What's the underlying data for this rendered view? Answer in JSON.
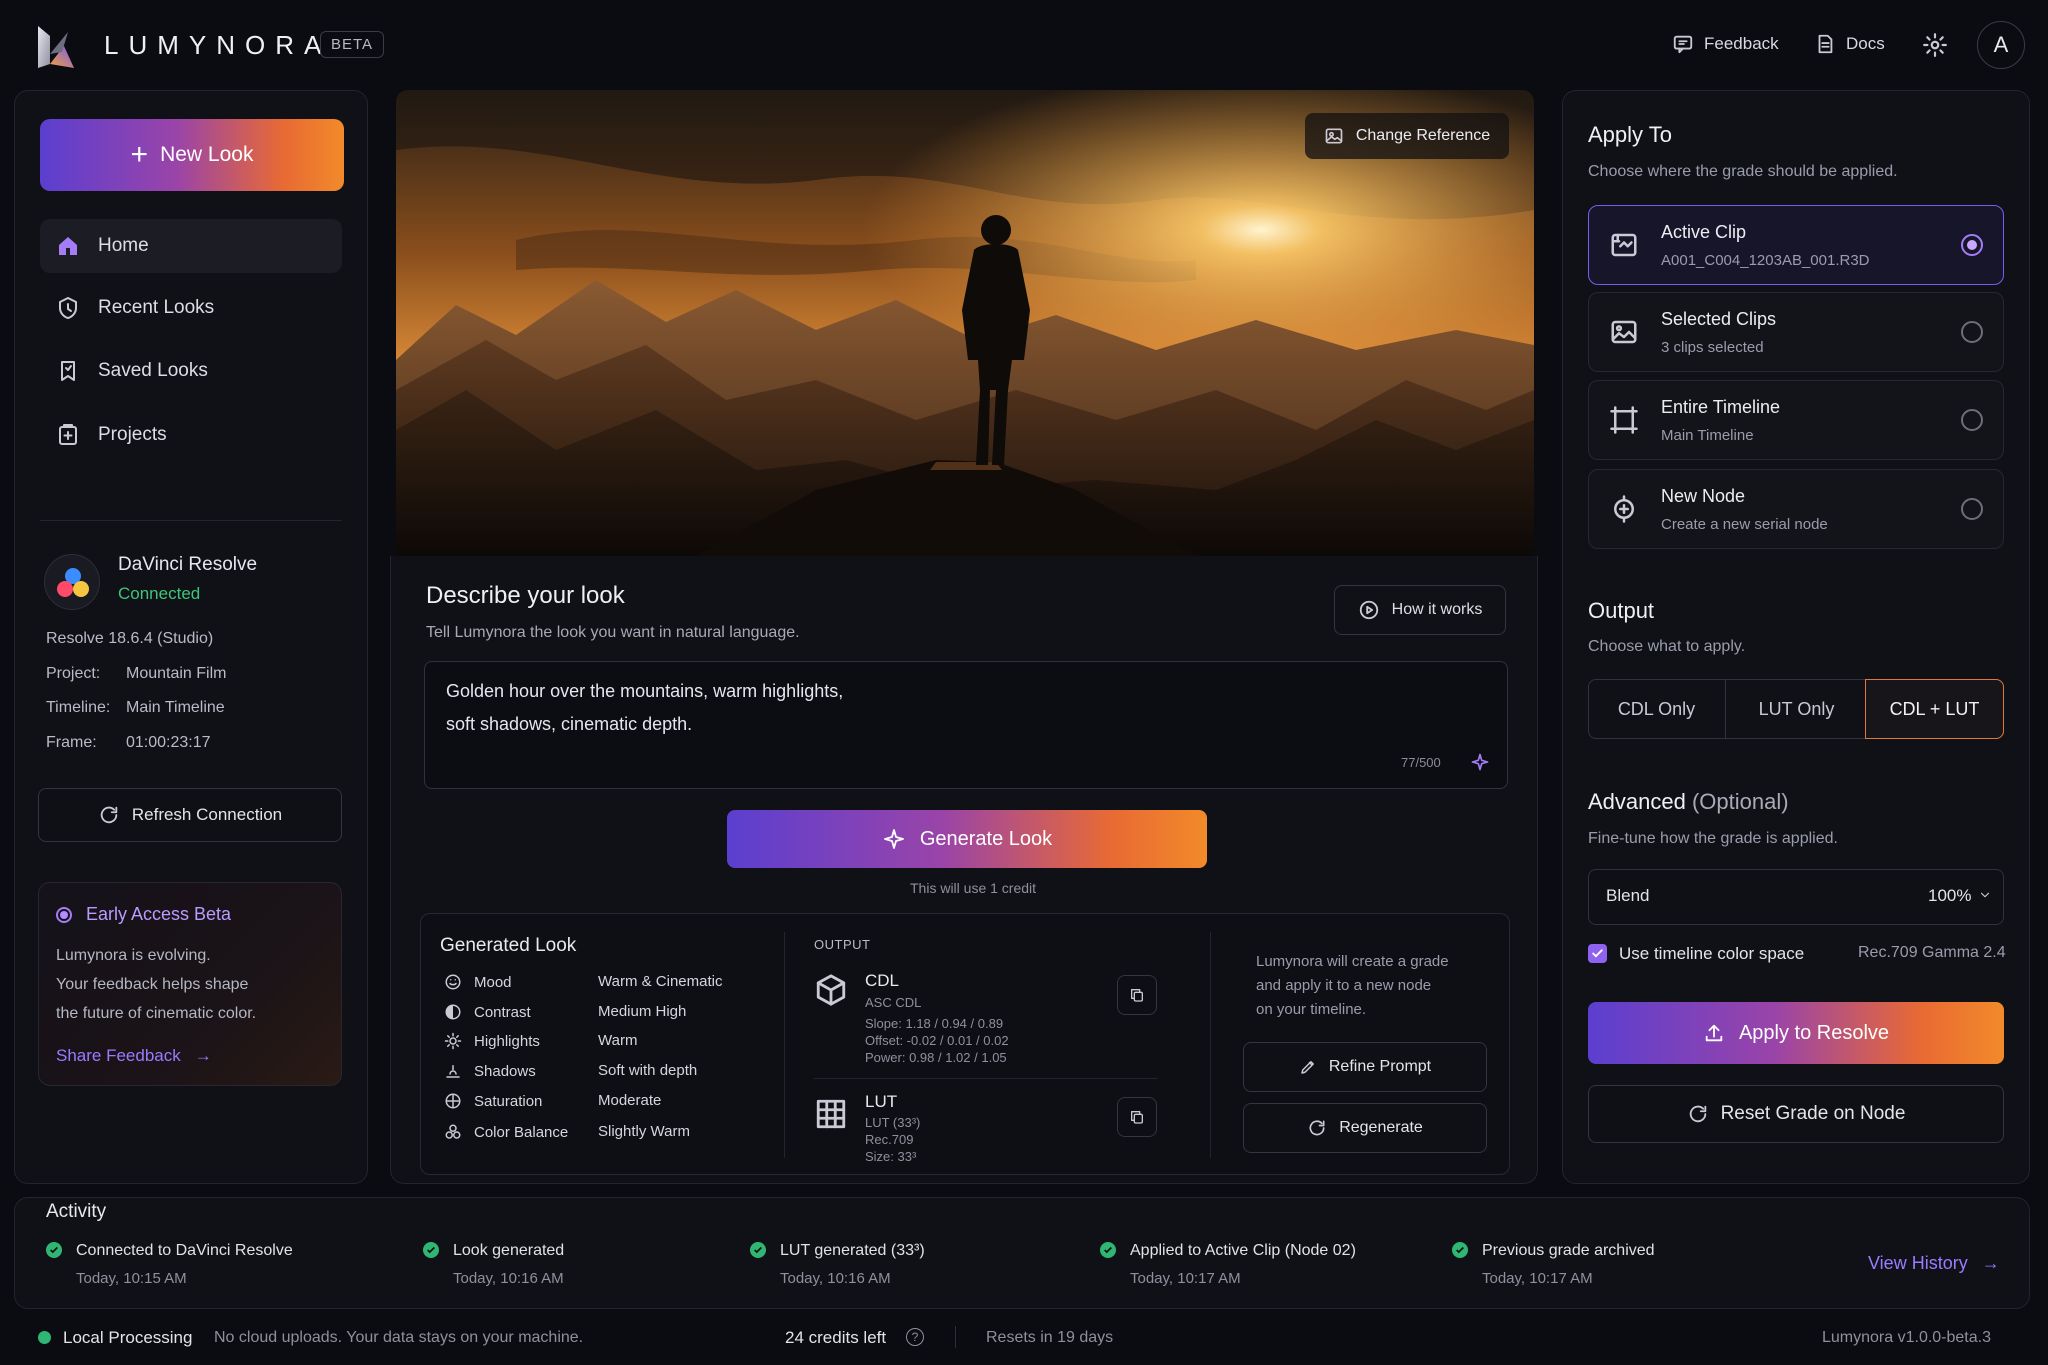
{
  "app": {
    "name": "LUMYNORA",
    "badge": "BETA"
  },
  "header": {
    "feedback": "Feedback",
    "docs": "Docs",
    "avatar": "A"
  },
  "sidebar": {
    "new_look": "New Look",
    "items": [
      {
        "label": "Home",
        "icon": "home-icon",
        "active": true
      },
      {
        "label": "Recent Looks",
        "icon": "recent-looks-icon"
      },
      {
        "label": "Saved Looks",
        "icon": "bookmark-icon"
      },
      {
        "label": "Projects",
        "icon": "project-icon"
      }
    ],
    "connection": {
      "app": "DaVinci Resolve",
      "status": "Connected",
      "version": "Resolve 18.6.4 (Studio)",
      "project_label": "Project:",
      "project": "Mountain Film",
      "timeline_label": "Timeline:",
      "timeline": "Main Timeline",
      "frame_label": "Frame:",
      "frame": "01:00:23:17",
      "refresh": "Refresh Connection"
    },
    "beta_card": {
      "title": "Early Access Beta",
      "line1": "Lumynora is evolving.",
      "line2": "Your feedback helps shape",
      "line3": "the future of cinematic color.",
      "link": "Share Feedback"
    }
  },
  "preview": {
    "change_reference": "Change Reference"
  },
  "describe": {
    "title": "Describe your look",
    "subtitle": "Tell Lumynora the look you want in natural language.",
    "how_it_works": "How it works",
    "prompt_line1": "Golden hour over the mountains, warm highlights,",
    "prompt_line2": "soft shadows, cinematic depth.",
    "char_count": "77/500",
    "generate": "Generate Look",
    "credit_note": "This will use 1 credit"
  },
  "generated": {
    "title": "Generated Look",
    "rows": [
      {
        "label": "Mood",
        "value": "Warm & Cinematic",
        "icon": "mood-icon"
      },
      {
        "label": "Contrast",
        "value": "Medium High",
        "icon": "contrast-icon"
      },
      {
        "label": "Highlights",
        "value": "Warm",
        "icon": "sun-icon"
      },
      {
        "label": "Shadows",
        "value": "Soft with depth",
        "icon": "shadows-icon"
      },
      {
        "label": "Saturation",
        "value": "Moderate",
        "icon": "saturation-icon"
      },
      {
        "label": "Color Balance",
        "value": "Slightly Warm",
        "icon": "balance-icon"
      }
    ],
    "output_label": "OUTPUT",
    "cdl": {
      "name": "CDL",
      "sub": "ASC CDL",
      "slope": "Slope: 1.18 / 0.94 / 0.89",
      "offset": "Offset: -0.02 / 0.01 / 0.02",
      "power": "Power: 0.98 / 1.02 / 1.05"
    },
    "lut": {
      "name": "LUT",
      "l1": "LUT (33³)",
      "l2": "Rec.709",
      "l3": "Size: 33³"
    },
    "note1": "Lumynora will create a grade",
    "note2": "and apply it to a new node",
    "note3": "on your timeline.",
    "refine": "Refine Prompt",
    "regenerate": "Regenerate"
  },
  "apply_to": {
    "title": "Apply To",
    "subtitle": "Choose where the grade should be applied.",
    "options": [
      {
        "title": "Active Clip",
        "sub": "A001_C004_1203AB_001.R3D",
        "selected": true
      },
      {
        "title": "Selected Clips",
        "sub": "3 clips selected"
      },
      {
        "title": "Entire Timeline",
        "sub": "Main Timeline"
      },
      {
        "title": "New Node",
        "sub": "Create a new serial node"
      }
    ]
  },
  "output": {
    "title": "Output",
    "subtitle": "Choose what to apply.",
    "options": [
      "CDL Only",
      "LUT Only",
      "CDL + LUT"
    ],
    "selected": "CDL + LUT"
  },
  "advanced": {
    "title": "Advanced",
    "optional": "(Optional)",
    "subtitle": "Fine-tune how the grade is applied.",
    "blend_label": "Blend",
    "blend_value": "100%",
    "use_color_space": "Use timeline color space",
    "color_space": "Rec.709 Gamma 2.4",
    "apply": "Apply to Resolve",
    "reset": "Reset Grade on Node"
  },
  "activity": {
    "title": "Activity",
    "items": [
      {
        "title": "Connected to DaVinci Resolve",
        "time": "Today, 10:15 AM"
      },
      {
        "title": "Look generated",
        "time": "Today, 10:16 AM"
      },
      {
        "title": "LUT generated (33³)",
        "time": "Today, 10:16 AM"
      },
      {
        "title": "Applied to Active Clip (Node 02)",
        "time": "Today, 10:17 AM"
      },
      {
        "title": "Previous grade archived",
        "time": "Today, 10:17 AM"
      }
    ],
    "view_history": "View History"
  },
  "status_bar": {
    "local": "Local Processing",
    "privacy": "No cloud uploads. Your data stays on your machine.",
    "credits": "24 credits left",
    "resets": "Resets in 19 days",
    "version": "Lumynora v1.0.0-beta.3"
  },
  "colors": {
    "accent_purple": "#7a5cf0",
    "accent_orange": "#f28a2a",
    "success": "#2fb673",
    "link": "#9a7bff"
  }
}
